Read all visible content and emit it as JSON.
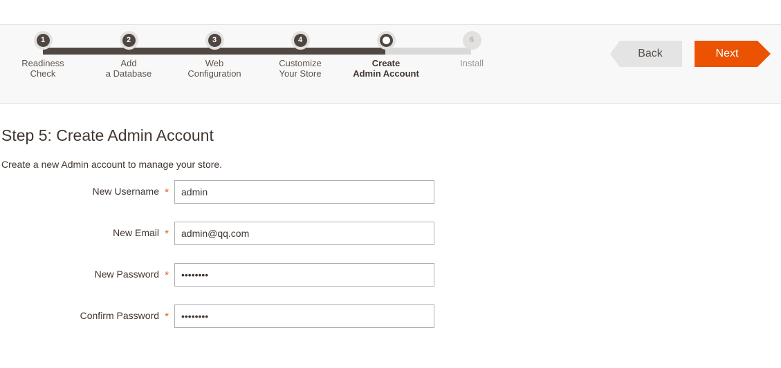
{
  "wizard": {
    "steps": [
      {
        "number": "1",
        "label": "Readiness\nCheck",
        "state": "done"
      },
      {
        "number": "2",
        "label": "Add\na Database",
        "state": "done"
      },
      {
        "number": "3",
        "label": "Web\nConfiguration",
        "state": "done"
      },
      {
        "number": "4",
        "label": "Customize\nYour Store",
        "state": "done"
      },
      {
        "number": "5",
        "label": "Create\nAdmin Account",
        "state": "current"
      },
      {
        "number": "6",
        "label": "Install",
        "state": "todo"
      }
    ],
    "back_label": "Back",
    "next_label": "Next",
    "accent_color": "#eb5202",
    "done_rail_color": "#514843",
    "todo_rail_color": "#d9d9d9"
  },
  "page": {
    "title": "Step 5: Create Admin Account",
    "subtitle": "Create a new Admin account to manage your store."
  },
  "form": {
    "required_marker": "*",
    "fields": [
      {
        "label": "New Username",
        "value": "admin",
        "placeholder": "",
        "type": "text"
      },
      {
        "label": "New Email",
        "value": "admin@qq.com",
        "placeholder": "",
        "type": "text"
      },
      {
        "label": "New Password",
        "value": "••••••••",
        "placeholder": "",
        "type": "password"
      },
      {
        "label": "Confirm Password",
        "value": "••••••••",
        "placeholder": "",
        "type": "password"
      }
    ]
  }
}
